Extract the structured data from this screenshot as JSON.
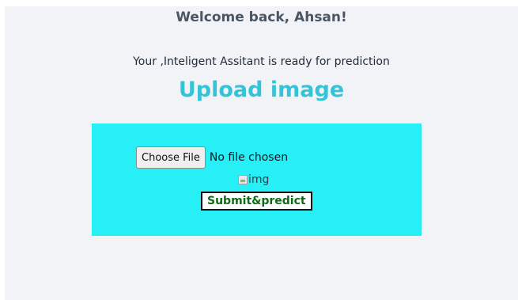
{
  "header": {
    "welcome": "Welcome back, Ahsan!",
    "subtitle": "Your ,Inteligent Assitant is ready for prediction",
    "upload_heading": "Upload image"
  },
  "form": {
    "choose_file_label": "Choose File",
    "file_status": "No file chosen",
    "image_alt": "img",
    "submit_label": "Submit&predict"
  },
  "colors": {
    "page_background": "#f1f3f7",
    "panel_background": "#26f0f5",
    "heading_accent": "#35c3d8",
    "submit_text": "#0b6b14"
  },
  "icons": {
    "broken_image": "broken-image-icon"
  }
}
